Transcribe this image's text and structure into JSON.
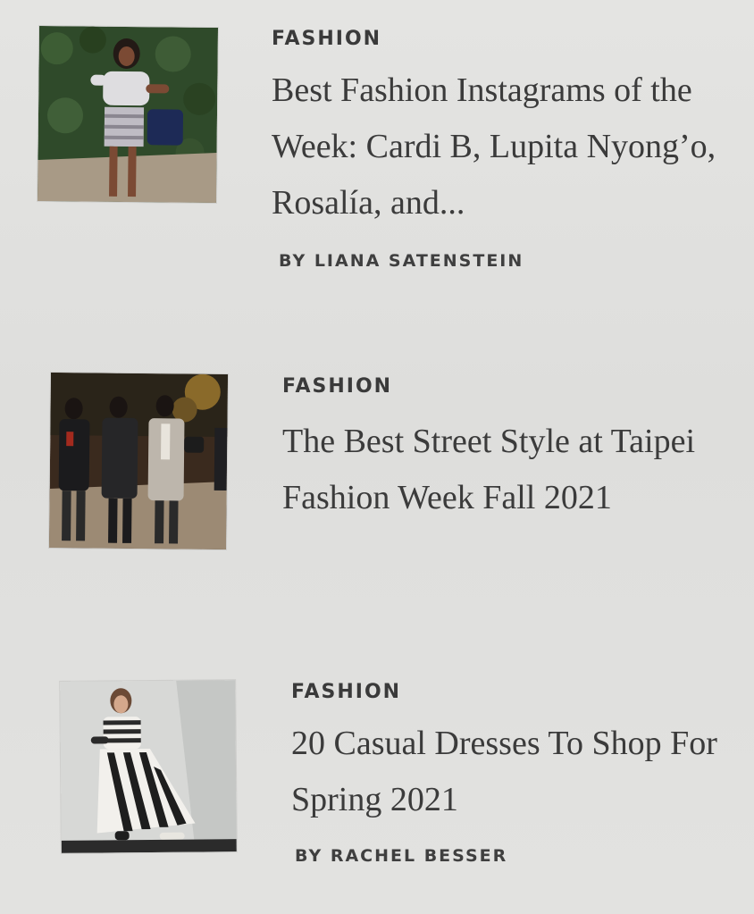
{
  "articles": [
    {
      "category": "FASHION",
      "headline": "Best Fashion Instagrams of the Week: Cardi B, Lupita Nyong’o, Rosalía, and...",
      "byline": "BY LIANA SATENSTEIN",
      "image_subject": "woman posing in front of hedge"
    },
    {
      "category": "FASHION",
      "headline": "The Best Street Style at Taipei Fashion Week Fall 2021",
      "byline": "",
      "image_subject": "group walking on street"
    },
    {
      "category": "FASHION",
      "headline": "20 Casual Dresses To Shop For Spring 2021",
      "byline": "BY RACHEL BESSER",
      "image_subject": "woman in striped dress"
    }
  ]
}
